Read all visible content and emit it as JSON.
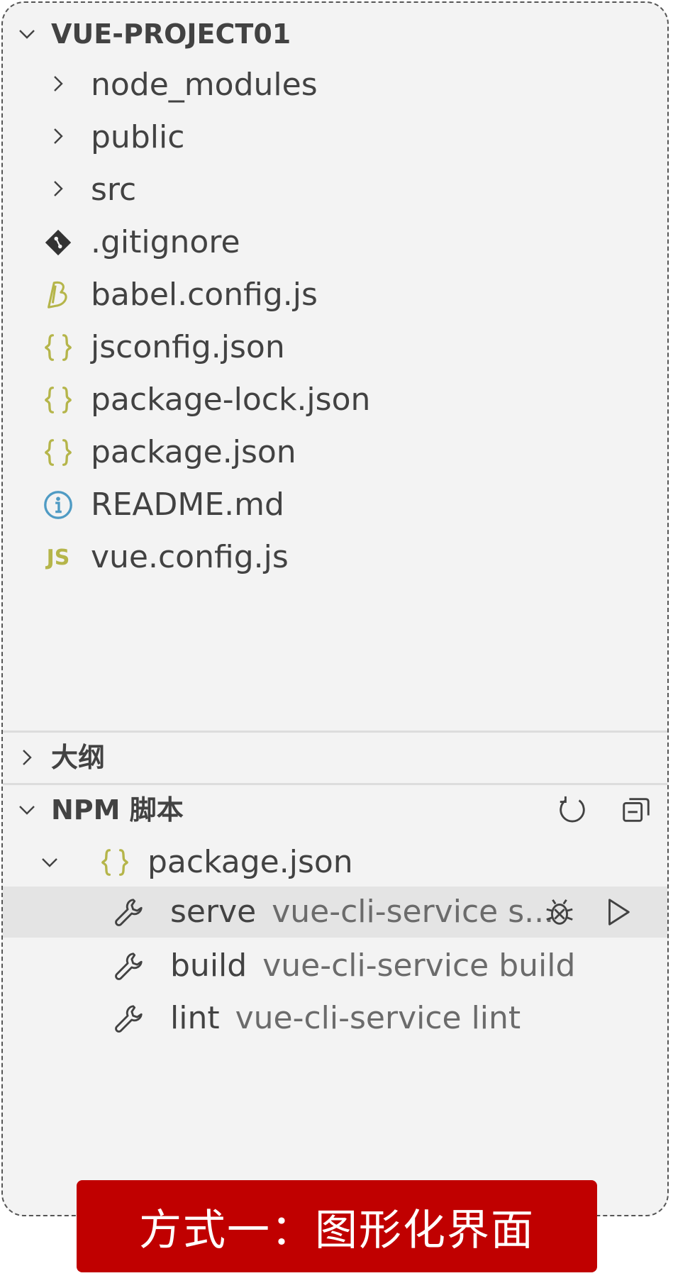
{
  "explorer": {
    "title": "VUE-PROJECT01",
    "items": [
      {
        "label": "node_modules",
        "icon": "chevron-right-icon"
      },
      {
        "label": "public",
        "icon": "chevron-right-icon"
      },
      {
        "label": "src",
        "icon": "chevron-right-icon"
      },
      {
        "label": ".gitignore",
        "icon": "git-icon"
      },
      {
        "label": "babel.config.js",
        "icon": "babel-icon"
      },
      {
        "label": "jsconfig.json",
        "icon": "json-icon"
      },
      {
        "label": "package-lock.json",
        "icon": "json-icon"
      },
      {
        "label": "package.json",
        "icon": "json-icon"
      },
      {
        "label": "README.md",
        "icon": "info-icon"
      },
      {
        "label": "vue.config.js",
        "icon": "js-icon",
        "glyph": "JS"
      }
    ]
  },
  "outline": {
    "title": "大纲"
  },
  "npm": {
    "title": "NPM 脚本",
    "package": "package.json",
    "scripts": [
      {
        "name": "serve",
        "command": "vue-cli-service s..."
      },
      {
        "name": "build",
        "command": "vue-cli-service build"
      },
      {
        "name": "lint",
        "command": "vue-cli-service lint"
      }
    ]
  },
  "banner": {
    "text": "方式一：图形化界面"
  },
  "colors": {
    "json_icon": "#b5b54a",
    "babel_icon": "#b5b54a",
    "info_icon": "#4f9bc4",
    "banner_bg": "#c00000",
    "highlight": "#e4e4e4"
  }
}
